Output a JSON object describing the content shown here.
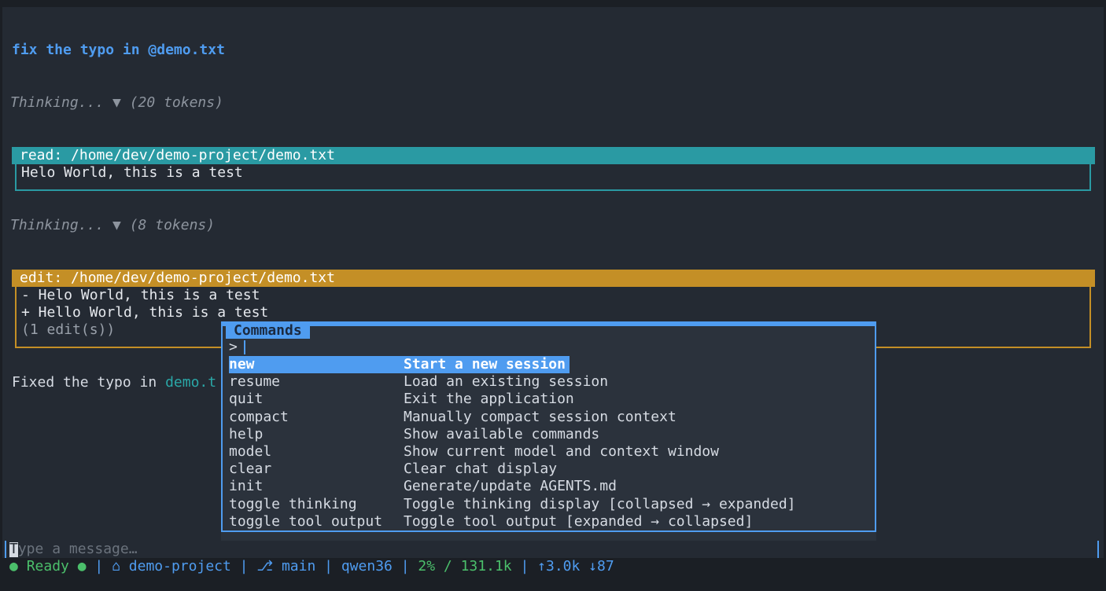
{
  "conversation": {
    "user_message": "fix the typo in @demo.txt",
    "thinking_1": "Thinking... ▼ (20 tokens)",
    "read_tool": {
      "header": "read: /home/dev/demo-project/demo.txt",
      "output": "Helo World, this is a test"
    },
    "thinking_2": "Thinking... ▼ (8 tokens)",
    "edit_tool": {
      "header": "edit: /home/dev/demo-project/demo.txt",
      "removed": "- Helo World, this is a test",
      "added": "+ Hello World, this is a test",
      "summary": "(1 edit(s))"
    },
    "assistant_prefix": "Fixed the typo in ",
    "assistant_link": "demo.t"
  },
  "command_palette": {
    "title": "Commands",
    "prompt": ">",
    "selected_index": 0,
    "commands": [
      {
        "name": "new",
        "description": "Start a new session"
      },
      {
        "name": "resume",
        "description": "Load an existing session"
      },
      {
        "name": "quit",
        "description": "Exit the application"
      },
      {
        "name": "compact",
        "description": "Manually compact session context"
      },
      {
        "name": "help",
        "description": "Show available commands"
      },
      {
        "name": "model",
        "description": "Show current model and context window"
      },
      {
        "name": "clear",
        "description": "Clear chat display"
      },
      {
        "name": "init",
        "description": "Generate/update AGENTS.md"
      },
      {
        "name": "toggle thinking",
        "description": "Toggle thinking display [collapsed → expanded]"
      },
      {
        "name": "toggle tool output",
        "description": "Toggle tool output [expanded → collapsed]"
      }
    ]
  },
  "input": {
    "placeholder_first": "T",
    "placeholder_rest": "ype a message…"
  },
  "status_bar": {
    "status_dot": "●",
    "status_label": "Ready",
    "activity_dot": "●",
    "sep": "|",
    "folder_icon": "⌂",
    "project": "demo-project",
    "branch_icon": "⎇",
    "branch": "main",
    "model": "qwen36",
    "context": "2% / 131.1k",
    "tokens": "↑3.0k ↓87"
  },
  "colors": {
    "background": "#242a33",
    "accent": "#4f9cf0",
    "read_tool": "#2a9aa3",
    "edit_tool": "#c48f26",
    "ok": "#4bbf6b"
  }
}
